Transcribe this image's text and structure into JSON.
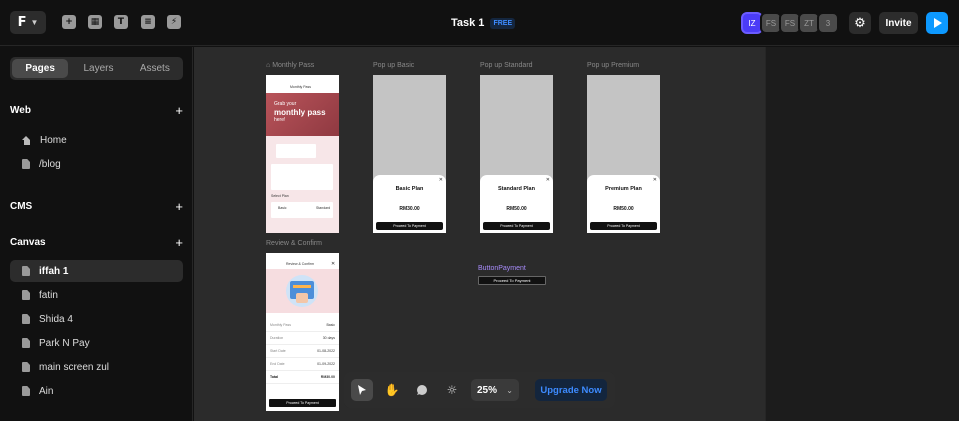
{
  "topbar": {
    "logo_glyph": "F",
    "file_title": "Task 1",
    "plan_badge": "FREE",
    "toolbar_icons": [
      "plus-icon",
      "layout-icon",
      "text-icon",
      "stack-icon",
      "bolt-icon"
    ],
    "avatars": [
      "IZ",
      "FS",
      "FS",
      "ZT"
    ],
    "avatar_overflow": "3",
    "invite_label": "Invite"
  },
  "sidebar": {
    "tabs": [
      "Pages",
      "Layers",
      "Assets"
    ],
    "web_heading": "Web",
    "web_items": [
      "Home",
      "/blog"
    ],
    "cms_heading": "CMS",
    "canvas_heading": "Canvas",
    "canvas_items": [
      "iffah 1",
      "fatin",
      "Shida 4",
      "Park N Pay",
      "main screen zul",
      "Ain"
    ]
  },
  "canvas": {
    "frames": {
      "monthly_pass": {
        "label": "Monthly Pass",
        "header": "Monthly Pass",
        "hero_line1": "Grab your",
        "hero_line2": "monthly pass",
        "hero_line3": "here!",
        "select_label": "Select Plan",
        "basic_label": "Basic",
        "standard_label": "Standard"
      },
      "popup_basic": {
        "label": "Pop up Basic",
        "plan": "Basic Plan",
        "price": "RM30.00",
        "button": "Proceed To Payment"
      },
      "popup_standard": {
        "label": "Pop up Standard",
        "plan": "Standard Plan",
        "price": "RM50.00",
        "button": "Proceed To Payment"
      },
      "popup_premium": {
        "label": "Pop up Premium",
        "plan": "Premium Plan",
        "price": "RM50.00",
        "button": "Proceed To Payment"
      },
      "review_confirm": {
        "label": "Review & Confirm",
        "header": "Review & Confirm",
        "rows": [
          {
            "l": "Monthly Pass",
            "v": "Basic"
          },
          {
            "l": "Duration",
            "v": "30 days"
          },
          {
            "l": "Start Date",
            "v": "01-08-2022"
          },
          {
            "l": "End Date",
            "v": "01-09-2022"
          },
          {
            "l": "Total",
            "v": "RM30.00"
          }
        ],
        "button": "Proceed To Payment"
      }
    },
    "component_label": "ButtonPayment",
    "component_button": "Proceed To Payment"
  },
  "bottombar": {
    "tools": [
      "cursor-icon",
      "hand-icon",
      "comment-icon",
      "brightness-icon"
    ],
    "zoom": "25%",
    "upgrade_label": "Upgrade Now"
  },
  "colors": {
    "accent": "#0d99ff",
    "current_user": "#4b3cf7",
    "component": "#a78bfa",
    "hero": "#b9545a"
  }
}
